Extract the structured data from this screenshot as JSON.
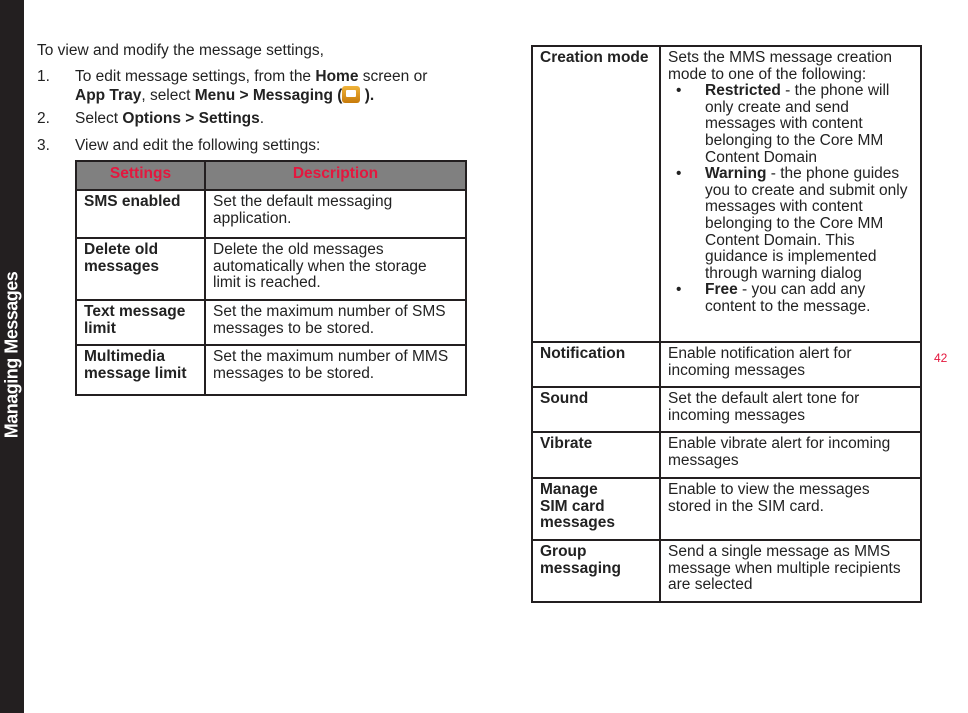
{
  "sidebar": {
    "title": "Managing Messages"
  },
  "intro": "To view and modify the message settings,",
  "steps": [
    {
      "num": "1.",
      "t1": "To edit message settings, from the ",
      "b1": "Home",
      "t2": " screen or ",
      "b2": "App Tray",
      "t3": ", select ",
      "b3": "Menu > Messaging",
      "t4": " (",
      "t5": " )."
    },
    {
      "num": "2.",
      "t1": "Select ",
      "b1": "Options > Settings",
      "t2": "."
    },
    {
      "num": "3.",
      "t1": "View and edit the following settings:"
    }
  ],
  "table1": {
    "headers": [
      "Settings",
      "Description"
    ],
    "rows": [
      {
        "k": "SMS enabled",
        "v": "Set the default messaging application."
      },
      {
        "k": "Delete old messages",
        "v": "Delete the old messages automatically when the storage limit is reached."
      },
      {
        "k": "Text message limit",
        "v": "Set the maximum number of SMS messages to be stored."
      },
      {
        "k": "Multimedia message limit",
        "v": "Set the maximum number of MMS messages to be stored."
      }
    ]
  },
  "table2": {
    "creation": {
      "k": "Creation mode",
      "v": "Sets the MMS message creation mode to one of the following:",
      "items": [
        {
          "b": "Restricted",
          "t": " - the phone will only create and send messages with content belonging to the Core MM Content Domain"
        },
        {
          "b": "Warning",
          "t": " - the phone guides you to create and submit only messages with content belonging to the Core MM Content Domain. This guidance is implemented through warning dialog"
        },
        {
          "b": "Free",
          "t": " -  you can add any content to the message."
        }
      ]
    },
    "rows": [
      {
        "k": "Notification",
        "v": "Enable notification alert for incoming messages"
      },
      {
        "k": "Sound",
        "v": "Set the default alert tone for incoming messages"
      },
      {
        "k": "Vibrate",
        "v": "Enable vibrate alert for incoming messages"
      },
      {
        "k": "Manage SIM card messages",
        "v": "Enable to view the messages stored in the SIM card."
      },
      {
        "k": "Group messaging",
        "v": "Send a single message  as MMS message when multiple recipients are selected"
      }
    ]
  },
  "page_number": "42",
  "icons": {
    "messaging": "messaging-app-icon"
  }
}
